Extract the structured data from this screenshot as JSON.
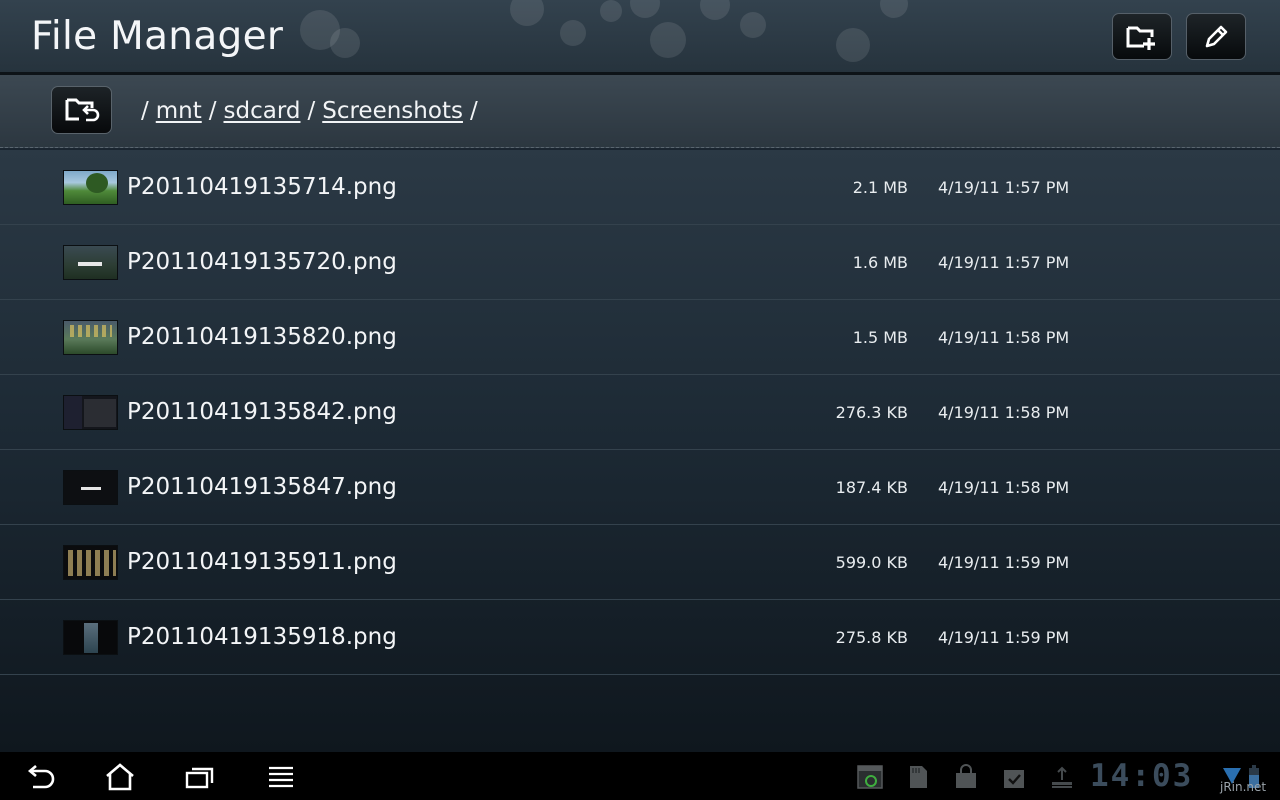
{
  "app": {
    "title": "File Manager"
  },
  "toolbar": {
    "new_folder_icon": "folder-plus-icon",
    "edit_icon": "pencil-icon"
  },
  "breadcrumb": {
    "up_icon": "folder-up-icon",
    "root_sep": "/",
    "segments": [
      "mnt",
      "sdcard",
      "Screenshots"
    ],
    "separator": "/"
  },
  "files": [
    {
      "name": "P20110419135714.png",
      "size": "2.1 MB",
      "date": "4/19/11 1:57 PM",
      "thumb": "green-meadow"
    },
    {
      "name": "P20110419135720.png",
      "size": "1.6 MB",
      "date": "4/19/11 1:57 PM",
      "thumb": "dark-dialog"
    },
    {
      "name": "P20110419135820.png",
      "size": "1.5 MB",
      "date": "4/19/11 1:58 PM",
      "thumb": "home-grid"
    },
    {
      "name": "P20110419135842.png",
      "size": "276.3 KB",
      "date": "4/19/11 1:58 PM",
      "thumb": "settings-dark"
    },
    {
      "name": "P20110419135847.png",
      "size": "187.4 KB",
      "date": "4/19/11 1:58 PM",
      "thumb": "black-dialog"
    },
    {
      "name": "P20110419135911.png",
      "size": "599.0 KB",
      "date": "4/19/11 1:59 PM",
      "thumb": "app-drawer"
    },
    {
      "name": "P20110419135918.png",
      "size": "275.8 KB",
      "date": "4/19/11 1:59 PM",
      "thumb": "gallery-dark"
    }
  ],
  "system_bar": {
    "nav": [
      "back-icon",
      "home-icon",
      "recent-apps-icon",
      "menu-icon"
    ],
    "status_icons": [
      "screenshot-icon",
      "sd-card-icon",
      "store-bag-icon",
      "task-check-icon",
      "usb-icon"
    ],
    "clock": "14:03",
    "watermark": "jRin.net"
  },
  "colors": {
    "accent_clock": "#3b4c5c",
    "wifi": "#2a6fb0"
  }
}
